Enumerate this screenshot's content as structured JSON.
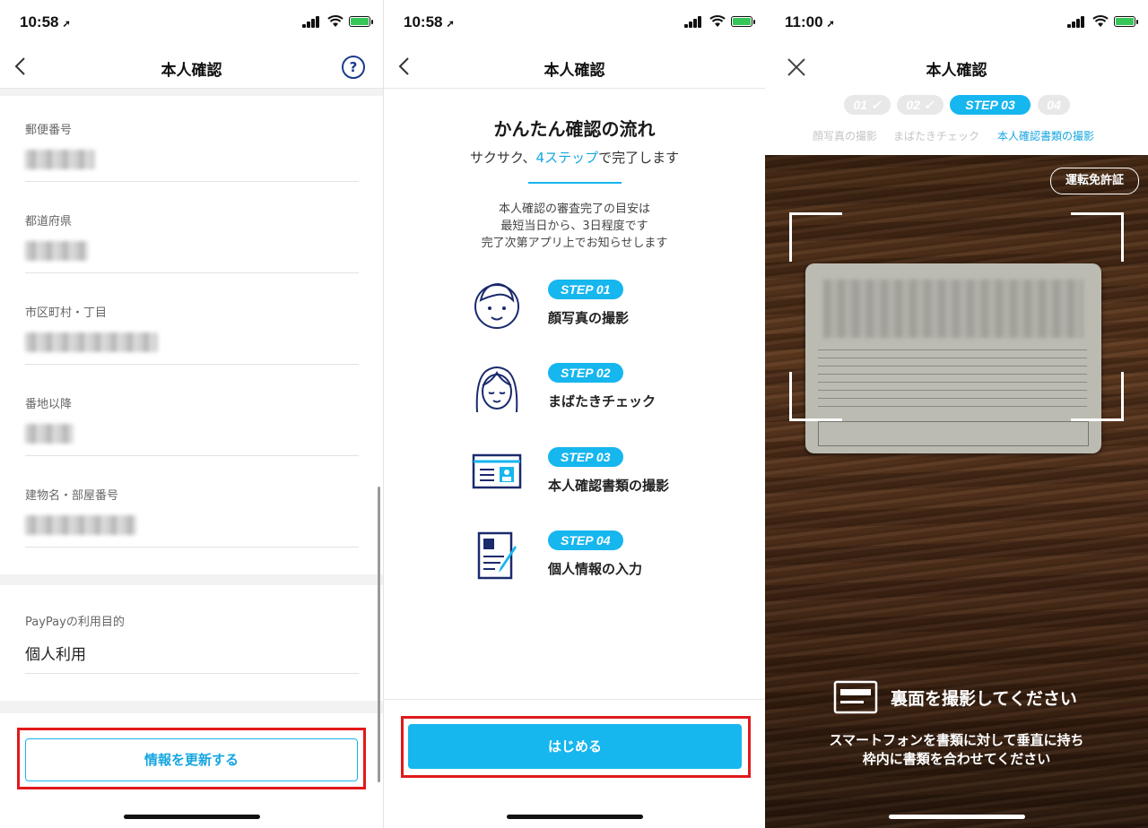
{
  "panel1": {
    "status": {
      "time": "10:58",
      "arrow": "➚"
    },
    "title": "本人確認",
    "help": "?",
    "fields": [
      {
        "label": "郵便番号"
      },
      {
        "label": "都道府県"
      },
      {
        "label": "市区町村・丁目"
      },
      {
        "label": "番地以降"
      },
      {
        "label": "建物名・部屋番号"
      }
    ],
    "purpose": {
      "label": "PayPayの利用目的",
      "value": "個人利用"
    },
    "update_button": "情報を更新する"
  },
  "panel2": {
    "status": {
      "time": "10:58",
      "arrow": "➚"
    },
    "title": "本人確認",
    "heading": "かんたん確認の流れ",
    "subtitle_pre": "サクサク、",
    "subtitle_hl": "4ステップ",
    "subtitle_post": "で完了します",
    "info": [
      "本人確認の審査完了の目安は",
      "最短当日から、3日程度です",
      "完了次第アプリ上でお知らせします"
    ],
    "steps": [
      {
        "badge": "STEP 01",
        "label": "顔写真の撮影",
        "icon": "face-icon"
      },
      {
        "badge": "STEP 02",
        "label": "まばたきチェック",
        "icon": "woman-face-icon"
      },
      {
        "badge": "STEP 03",
        "label": "本人確認書類の撮影",
        "icon": "id-card-icon"
      },
      {
        "badge": "STEP 04",
        "label": "個人情報の入力",
        "icon": "form-pen-icon"
      }
    ],
    "start_button": "はじめる"
  },
  "panel3": {
    "status": {
      "time": "11:00",
      "arrow": "➚"
    },
    "title": "本人確認",
    "chips": [
      "01 ✓",
      "02 ✓",
      "STEP 03",
      "04"
    ],
    "chip_labels": [
      "顔写真の撮影",
      "まばたきチェック",
      "本人確認書類の撮影"
    ],
    "doc_type": "運転免許証",
    "guide_title": "裏面を撮影してください",
    "guide_lines": [
      "スマートフォンを書類に対して垂直に持ち",
      "枠内に書類を合わせてください"
    ]
  },
  "colors": {
    "accent": "#16b6ee",
    "navy": "#1a3c8c",
    "highlight_box": "#e0191b"
  }
}
